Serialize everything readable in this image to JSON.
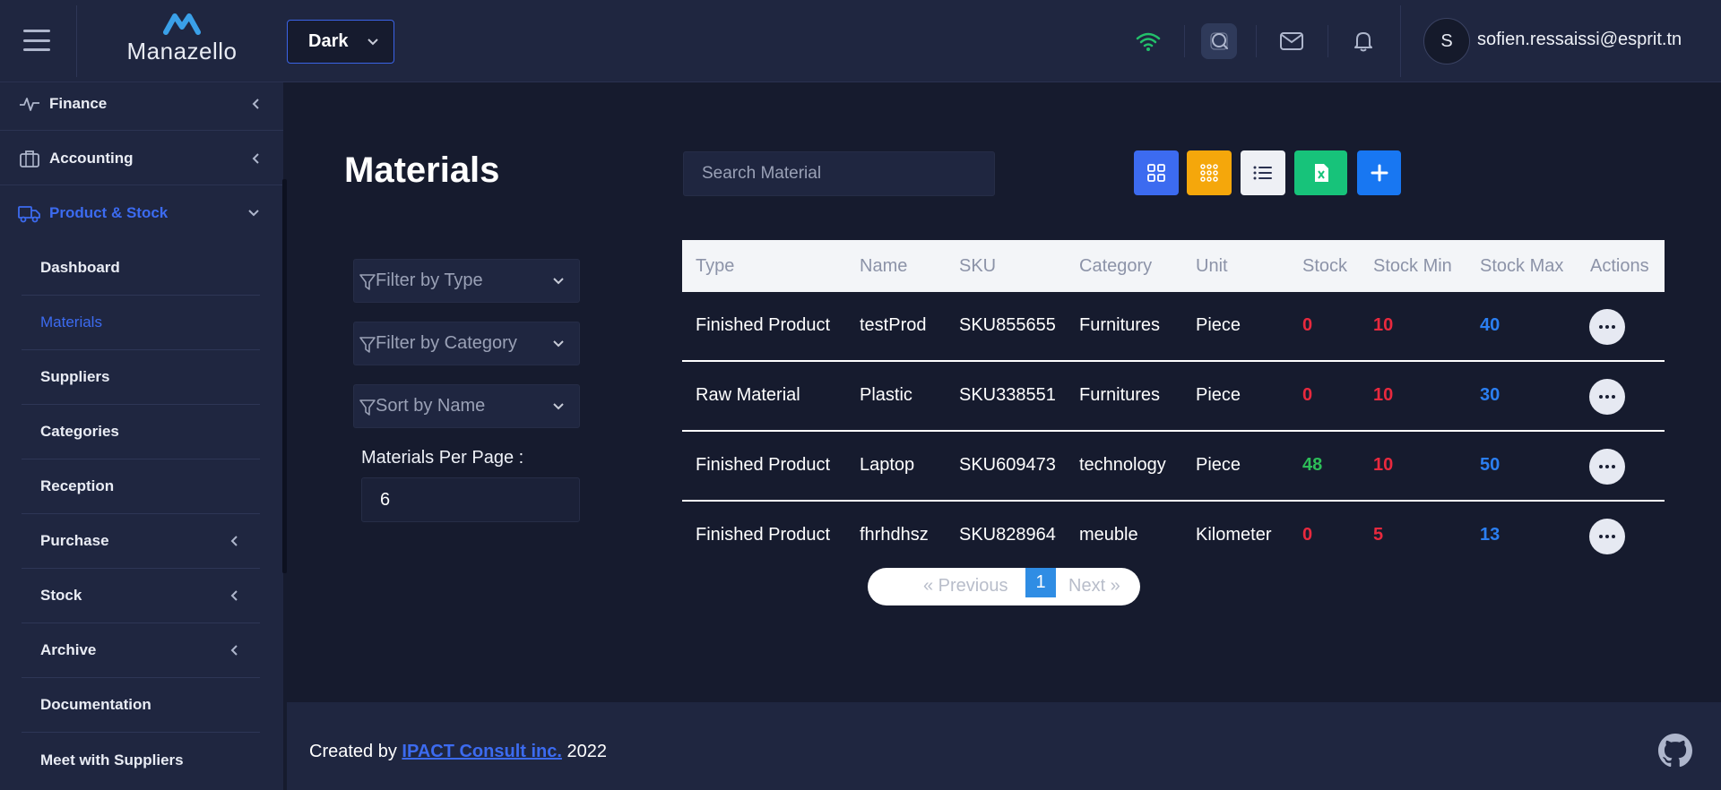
{
  "header": {
    "logo_text": "Manazello",
    "theme": "Dark",
    "avatar_initial": "S",
    "user_email": "sofien.ressaissi@esprit.tn"
  },
  "sidebar": {
    "items": [
      {
        "label": "Finance"
      },
      {
        "label": "Accounting"
      },
      {
        "label": "Product & Stock"
      }
    ],
    "subitems": [
      {
        "label": "Dashboard"
      },
      {
        "label": "Materials"
      },
      {
        "label": "Suppliers"
      },
      {
        "label": "Categories"
      },
      {
        "label": "Reception"
      },
      {
        "label": "Purchase"
      },
      {
        "label": "Stock"
      },
      {
        "label": "Archive"
      },
      {
        "label": "Documentation"
      },
      {
        "label": "Meet with Suppliers"
      }
    ]
  },
  "main": {
    "title": "Materials",
    "search_placeholder": "Search Material",
    "filters": {
      "type": "Filter by Type",
      "category": "Filter by Category",
      "sort": "Sort by Name"
    },
    "per_page_label": "Materials Per Page :",
    "per_page_value": "6"
  },
  "table": {
    "columns": [
      "Type",
      "Name",
      "SKU",
      "Category",
      "Unit",
      "Stock",
      "Stock Min",
      "Stock Max",
      "Actions"
    ],
    "rows": [
      {
        "type": "Finished Product",
        "name": "testProd",
        "sku": "SKU855655",
        "category": "Furnitures",
        "unit": "Piece",
        "stock": "0",
        "stock_min": "10",
        "stock_max": "40"
      },
      {
        "type": "Raw Material",
        "name": "Plastic",
        "sku": "SKU338551",
        "category": "Furnitures",
        "unit": "Piece",
        "stock": "0",
        "stock_min": "10",
        "stock_max": "30"
      },
      {
        "type": "Finished Product",
        "name": "Laptop",
        "sku": "SKU609473",
        "category": "technology",
        "unit": "Piece",
        "stock": "48",
        "stock_min": "10",
        "stock_max": "50"
      },
      {
        "type": "Finished Product",
        "name": "fhrhdhsz",
        "sku": "SKU828964",
        "category": "meuble",
        "unit": "Kilometer",
        "stock": "0",
        "stock_min": "5",
        "stock_max": "13"
      }
    ]
  },
  "pagination": {
    "previous": "«   Previous",
    "current": "1",
    "next": "Next   »"
  },
  "footer": {
    "prefix": "Created by",
    "company": "IPACT Consult inc.",
    "year": "2022"
  },
  "colors": {
    "accent": "#3c6bf0",
    "background": "#161b2e",
    "panel": "#1f2640",
    "danger": "#e8293e",
    "success": "#2dbd58",
    "info": "#2b7ff2",
    "grid_btn": "#3c6bf0",
    "apps_btn": "#f5a70b",
    "list_btn": "#eef0f5",
    "excel_btn": "#17c37a",
    "add_btn": "#1877f2"
  }
}
